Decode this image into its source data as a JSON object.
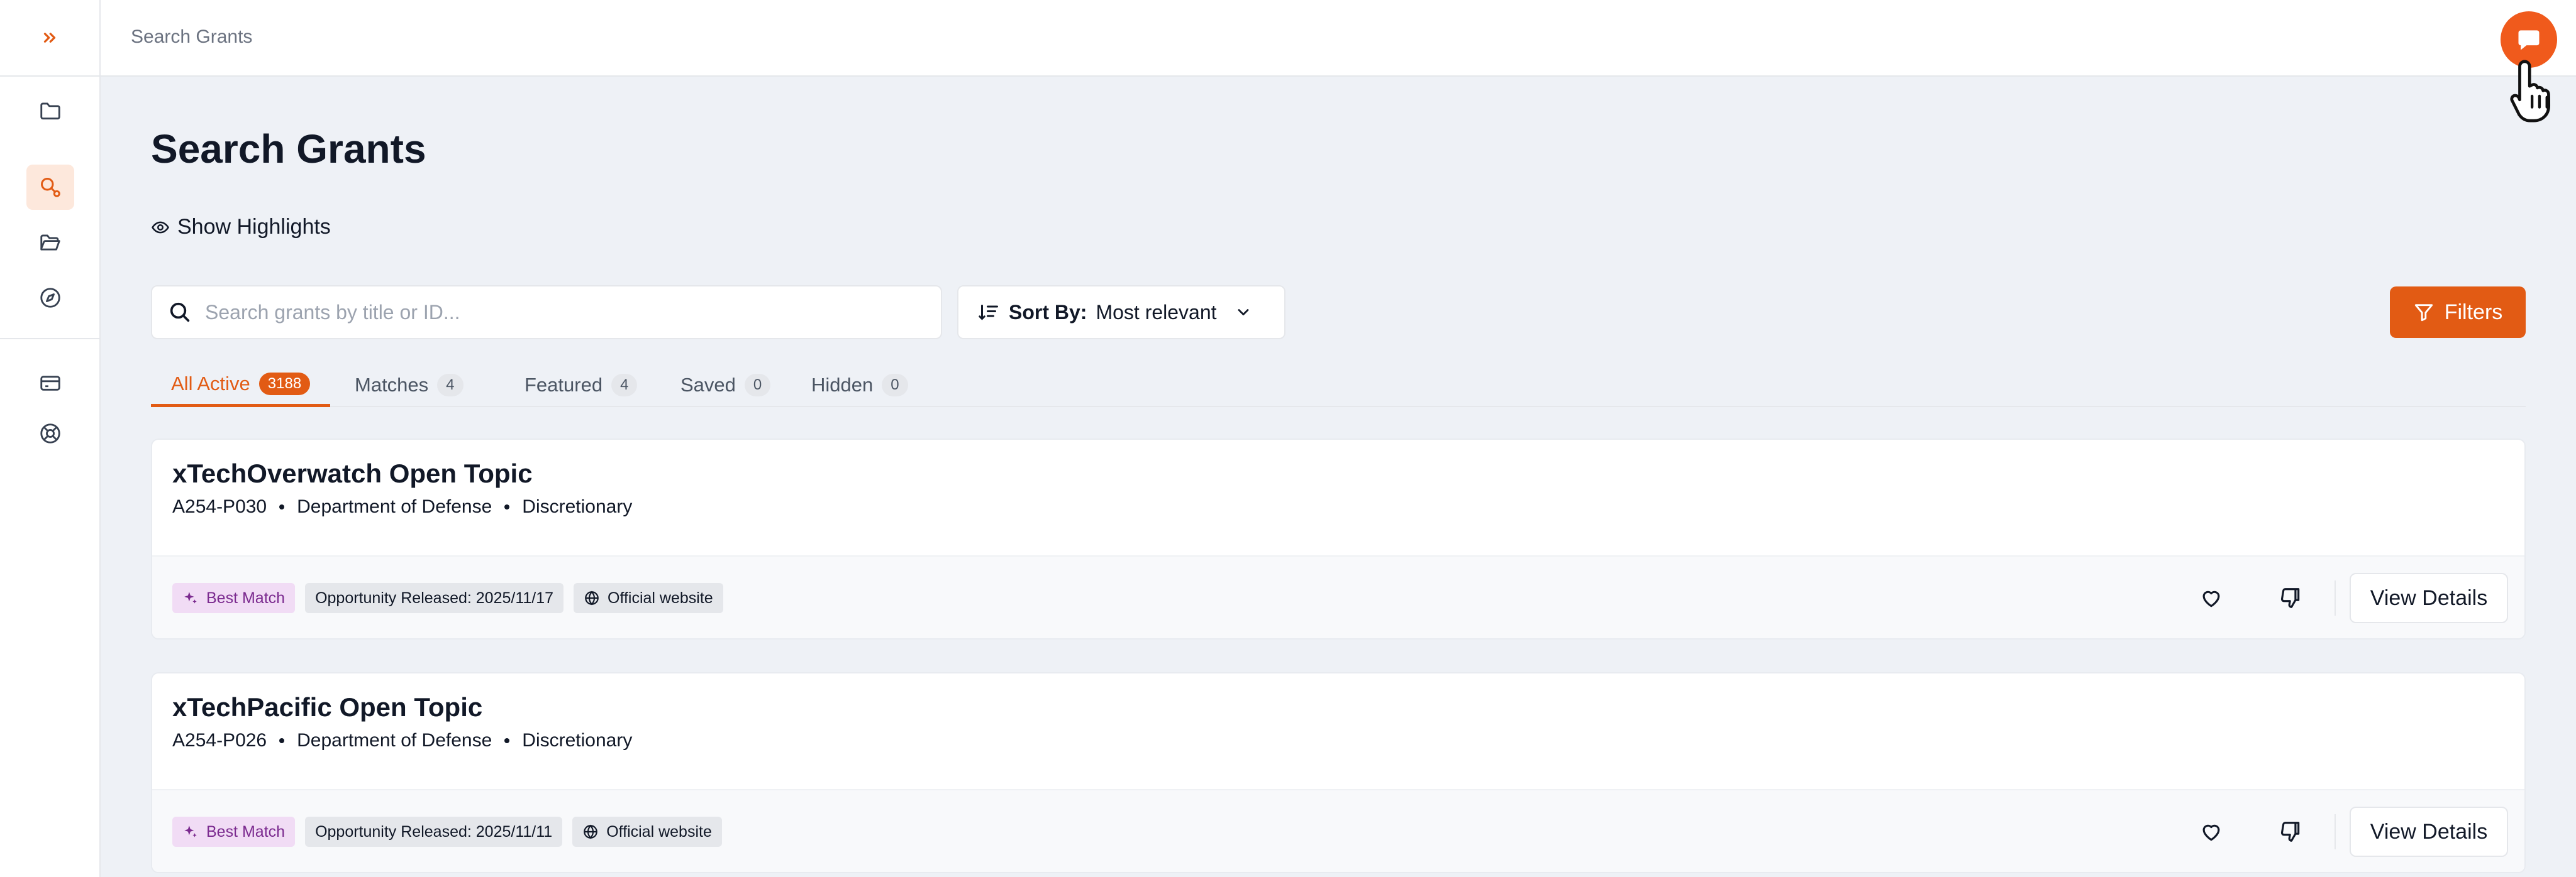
{
  "breadcrumb": "Search Grants",
  "page": {
    "title": "Search Grants",
    "show_highlights": "Show Highlights"
  },
  "search": {
    "placeholder": "Search grants by title or ID...",
    "value": ""
  },
  "sort": {
    "label": "Sort By:",
    "value": "Most relevant"
  },
  "filters_label": "Filters",
  "tabs": [
    {
      "label": "All Active",
      "count": "3188",
      "active": true
    },
    {
      "label": "Matches",
      "count": "4"
    },
    {
      "label": "Featured",
      "count": "4"
    },
    {
      "label": "Saved",
      "count": "0"
    },
    {
      "label": "Hidden",
      "count": "0"
    }
  ],
  "grants": [
    {
      "title": "xTechOverwatch Open Topic",
      "id": "A254-P030",
      "agency": "Department of Defense",
      "type": "Discretionary",
      "match_tag": "Best Match",
      "released": "Opportunity Released: 2025/11/17",
      "website": "Official website",
      "view_label": "View Details"
    },
    {
      "title": "xTechPacific Open Topic",
      "id": "A254-P026",
      "agency": "Department of Defense",
      "type": "Discretionary",
      "match_tag": "Best Match",
      "released": "Opportunity Released: 2025/11/11",
      "website": "Official website",
      "view_label": "View Details"
    }
  ],
  "colors": {
    "accent": "#e25b14",
    "chat_button": "#f05a1c",
    "best_match_bg": "#f1dcf5",
    "best_match_text": "#7b2a8f"
  },
  "icons": {
    "sidebar": [
      "expand-chevrons-icon",
      "folder-icon",
      "search-grants-icon",
      "folder-open-icon",
      "compass-icon",
      "credit-card-icon",
      "support-lifebuoy-icon"
    ],
    "chat": "chat-icon"
  }
}
